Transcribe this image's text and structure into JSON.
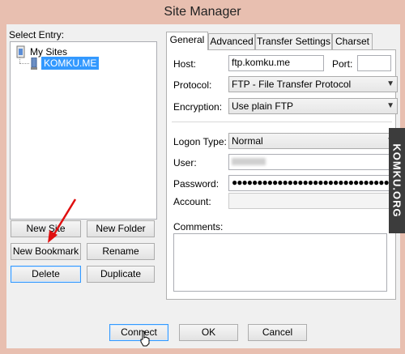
{
  "window": {
    "title": "Site Manager"
  },
  "tree": {
    "label": "Select Entry:",
    "root": "My Sites",
    "site": "KOMKU.ME"
  },
  "left_buttons": {
    "new_site": "New Site",
    "new_folder": "New Folder",
    "new_bookmark": "New Bookmark",
    "rename": "Rename",
    "delete": "Delete",
    "duplicate": "Duplicate"
  },
  "tabs": [
    "General",
    "Advanced",
    "Transfer Settings",
    "Charset"
  ],
  "general": {
    "host_label": "Host:",
    "host_value": "ftp.komku.me",
    "port_label": "Port:",
    "port_value": "",
    "protocol_label": "Protocol:",
    "protocol_value": "FTP - File Transfer Protocol",
    "encryption_label": "Encryption:",
    "encryption_value": "Use plain FTP",
    "logon_type_label": "Logon Type:",
    "logon_type_value": "Normal",
    "user_label": "User:",
    "password_label": "Password:",
    "password_value": "●●●●●●●●●●●●●●●●●●●●●●●●●●●●●●●●●●●●●●●●",
    "account_label": "Account:",
    "comments_label": "Comments:"
  },
  "bottom_buttons": {
    "connect": "Connect",
    "ok": "OK",
    "cancel": "Cancel"
  },
  "watermark": "KOMKU.ORG"
}
